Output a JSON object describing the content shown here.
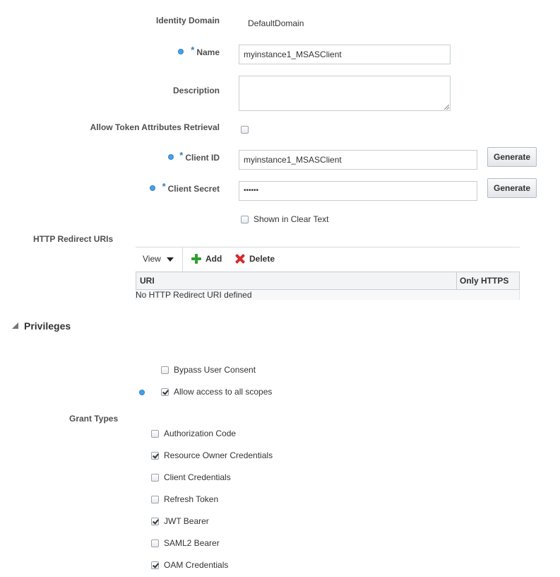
{
  "identity_domain": {
    "label": "Identity Domain",
    "value": "DefaultDomain"
  },
  "name": {
    "label": "Name",
    "required_marker": "*",
    "value": "myinstance1_MSASClient"
  },
  "description": {
    "label": "Description",
    "value": ""
  },
  "allow_token": {
    "label": "Allow Token Attributes Retrieval",
    "checked": false
  },
  "client_id": {
    "label": "Client ID",
    "required_marker": "*",
    "value": "myinstance1_MSASClient",
    "button": "Generate"
  },
  "client_secret": {
    "label": "Client Secret",
    "required_marker": "*",
    "value": "••••••",
    "button": "Generate"
  },
  "shown_clear": {
    "label": "Shown in Clear Text",
    "checked": false
  },
  "redirect": {
    "label": "HTTP Redirect URIs",
    "toolbar": {
      "view": "View",
      "add": "Add",
      "delete": "Delete"
    },
    "columns": [
      "URI",
      "Only HTTPS"
    ],
    "empty_text": "No HTTP Redirect URI defined"
  },
  "privileges": {
    "title": "Privileges",
    "bypass": {
      "label": "Bypass User Consent",
      "checked": false
    },
    "allow_scopes": {
      "label": "Allow access to all scopes",
      "checked": true
    }
  },
  "grant_types": {
    "label": "Grant Types",
    "items": [
      {
        "label": "Authorization Code",
        "checked": false
      },
      {
        "label": "Resource Owner Credentials",
        "checked": true
      },
      {
        "label": "Client Credentials",
        "checked": false
      },
      {
        "label": "Refresh Token",
        "checked": false
      },
      {
        "label": "JWT Bearer",
        "checked": true
      },
      {
        "label": "SAML2 Bearer",
        "checked": false
      },
      {
        "label": "OAM Credentials",
        "checked": true
      }
    ]
  },
  "colors": {
    "accent_dot": "#4aa0e6",
    "add_icon": "#2ea02e",
    "delete_icon": "#d62b2b"
  }
}
